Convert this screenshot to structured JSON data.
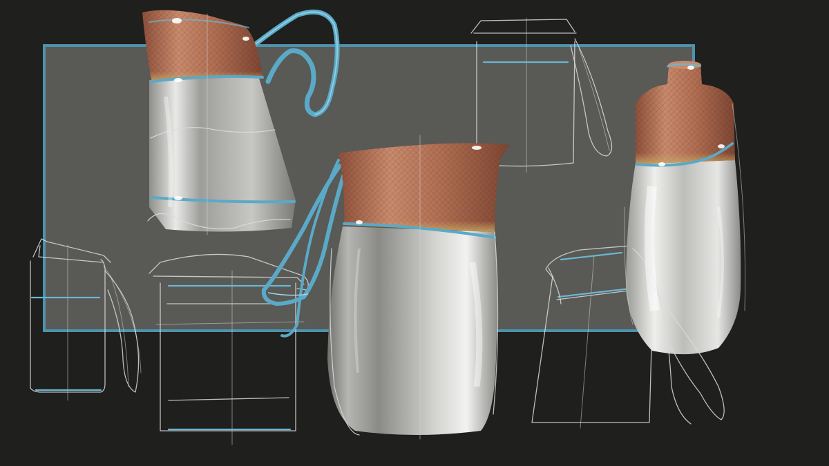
{
  "scene": {
    "background_color": "#1f1f1d",
    "panel_color": "#595956",
    "panel_border_color": "#4d93ad",
    "copper_color": "#b8775c",
    "gold_color": "#c8a86a",
    "accent_blue": "#5aa9c7",
    "glass_color": "#b9b9b6"
  },
  "objects": [
    "rendered-pitcher-tall",
    "rendered-pitcher-wide",
    "rendered-bottle",
    "sketch-box-jug-top",
    "sketch-bottle-small",
    "sketch-box-jug-low",
    "sketch-chair-jug"
  ]
}
